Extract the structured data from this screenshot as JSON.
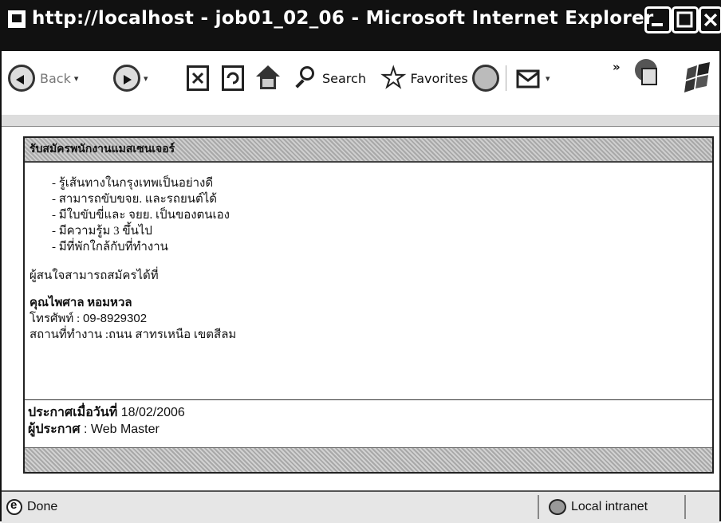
{
  "window": {
    "title": "http://localhost - job01_02_06 - Microsoft Internet Explorer"
  },
  "toolbar": {
    "back_label": "Back",
    "search_label": "Search",
    "favorites_label": "Favorites",
    "chevron_label": "»"
  },
  "job": {
    "heading": "รับสมัครพนักงานแมสเซนเจอร์",
    "requirements": [
      "รู้เส้นทางในกรุงเทพเป็นอย่างดี",
      "สามารถขับขจย. และรถยนต์ได้",
      "มีใบขับขี่และ จยย. เป็นของตนเอง",
      "มีความรู้ม 3 ขึ้นไป",
      "มีที่พักใกล้กับที่ทำงาน"
    ],
    "apply_text": "ผู้สนใจสามารถสมัครได้ที่",
    "contact_name": "คุณไพศาล หอมหวล",
    "phone_label": "โทรศัพท์ :",
    "phone": "09-8929302",
    "workplace_label": "สถานที่ทำงาน :",
    "workplace": "ถนน สาทรเหนือ เขตสีลม",
    "posted_label": "ประกาศเมื่อวันที่",
    "posted_date": "18/02/2006",
    "poster_label": "ผู้ประกาศ",
    "poster": ": Web Master"
  },
  "status": {
    "left": "Done",
    "zone": "Local intranet"
  }
}
